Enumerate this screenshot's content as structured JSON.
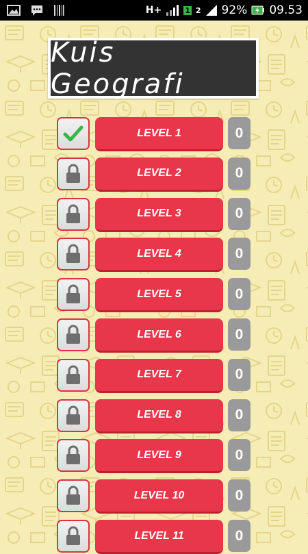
{
  "status_bar": {
    "network_type": "H+",
    "sim1_label": "1",
    "sim2_label": "2",
    "battery_percent": "92%",
    "time": "09.53",
    "icons": [
      "gallery-icon",
      "chat-icon",
      "barcode-icon",
      "signal-icon",
      "battery-charging-icon"
    ]
  },
  "title": "Kuis Geografi",
  "levels": [
    {
      "label": "LEVEL 1",
      "score": "0",
      "status": "completed"
    },
    {
      "label": "LEVEL 2",
      "score": "0",
      "status": "locked"
    },
    {
      "label": "LEVEL 3",
      "score": "0",
      "status": "locked"
    },
    {
      "label": "LEVEL 4",
      "score": "0",
      "status": "locked"
    },
    {
      "label": "LEVEL 5",
      "score": "0",
      "status": "locked"
    },
    {
      "label": "LEVEL 6",
      "score": "0",
      "status": "locked"
    },
    {
      "label": "LEVEL 7",
      "score": "0",
      "status": "locked"
    },
    {
      "label": "LEVEL 8",
      "score": "0",
      "status": "locked"
    },
    {
      "label": "LEVEL 9",
      "score": "0",
      "status": "locked"
    },
    {
      "label": "LEVEL 10",
      "score": "0",
      "status": "locked"
    },
    {
      "label": "LEVEL 11",
      "score": "0",
      "status": "locked"
    }
  ],
  "colors": {
    "background": "#f6edb6",
    "level_button": "#e8374a",
    "status_border": "#d8333f",
    "score_box": "#9a9a9a",
    "check": "#3ab54a",
    "lock": "#6e6e6e"
  }
}
